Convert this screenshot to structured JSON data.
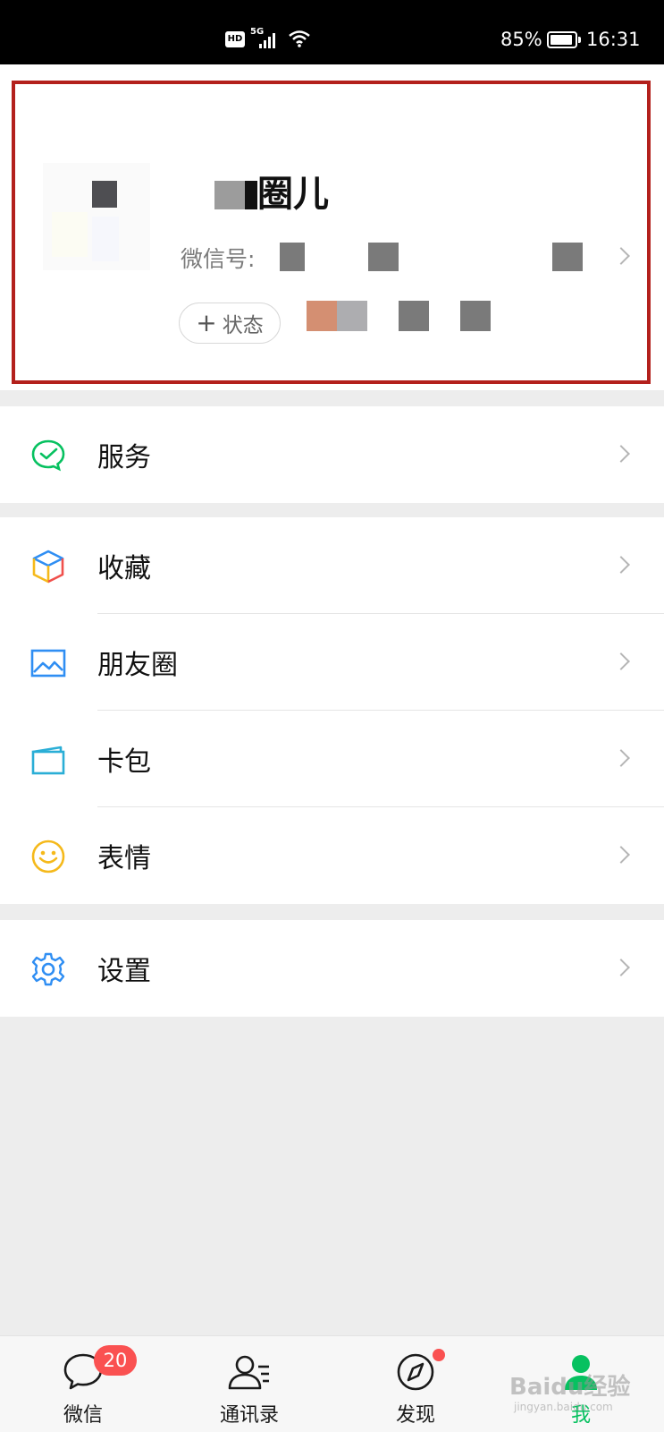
{
  "status_bar": {
    "hd": "HD",
    "network": "5G",
    "battery_percent": "85%",
    "battery_level": 0.85,
    "time": "16:31"
  },
  "profile": {
    "nickname": "圈儿",
    "wechat_id_label": "微信号:",
    "status_button": "状态",
    "highlight_color": "#b3201c"
  },
  "menu": {
    "service": {
      "label": "服务",
      "icon": "wechat-pay-check-icon"
    },
    "favorites": {
      "label": "收藏",
      "icon": "cube-icon"
    },
    "moments": {
      "label": "朋友圈",
      "icon": "image-icon"
    },
    "cards": {
      "label": "卡包",
      "icon": "wallet-card-icon"
    },
    "stickers": {
      "label": "表情",
      "icon": "smiley-icon"
    },
    "settings": {
      "label": "设置",
      "icon": "gear-icon"
    }
  },
  "tabbar": {
    "tabs": [
      {
        "label": "微信",
        "icon": "chat-bubble-icon",
        "badge": "20"
      },
      {
        "label": "通讯录",
        "icon": "contacts-icon"
      },
      {
        "label": "发现",
        "icon": "compass-icon",
        "dot": true
      },
      {
        "label": "我",
        "icon": "person-icon",
        "active": true
      }
    ],
    "accent_color": "#07c160",
    "badge_color": "#fa5151"
  },
  "watermark": {
    "text": "Baidu经验",
    "subtext": "jingyan.baidu.com"
  }
}
